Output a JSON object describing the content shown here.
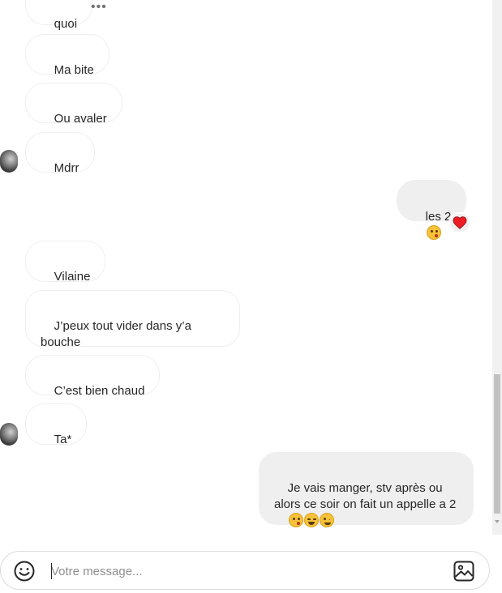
{
  "messages": {
    "in_quoi": "quoi",
    "in_ma_bite": "Ma bite",
    "in_ou_avaler": "Ou avaler",
    "in_mdrr": "Mdrr",
    "out_les2": "les 2",
    "in_vilaine": "Vilaine",
    "in_jpeux": "J’peux tout vider dans y’a bouche",
    "in_cest": "C’est bien chaud",
    "in_ta": "Ta*",
    "out_manger": "Je vais manger, stv après ou alors ce soir on fait un appelle a 2"
  },
  "icons": {
    "more": "more-options-icon",
    "reaction": "red-heart",
    "emoji_picker": "smiley-face-icon",
    "attach_image": "image-icon",
    "emoji_les2": "kissing-face",
    "emoji_manger": [
      "kissing-face",
      "smiling-face",
      "winking-face"
    ]
  },
  "composer": {
    "placeholder": "Votre message..."
  },
  "colors": {
    "outgoing_bubble": "#efefef",
    "incoming_border": "#efefef",
    "heart": "#ed1c24"
  }
}
